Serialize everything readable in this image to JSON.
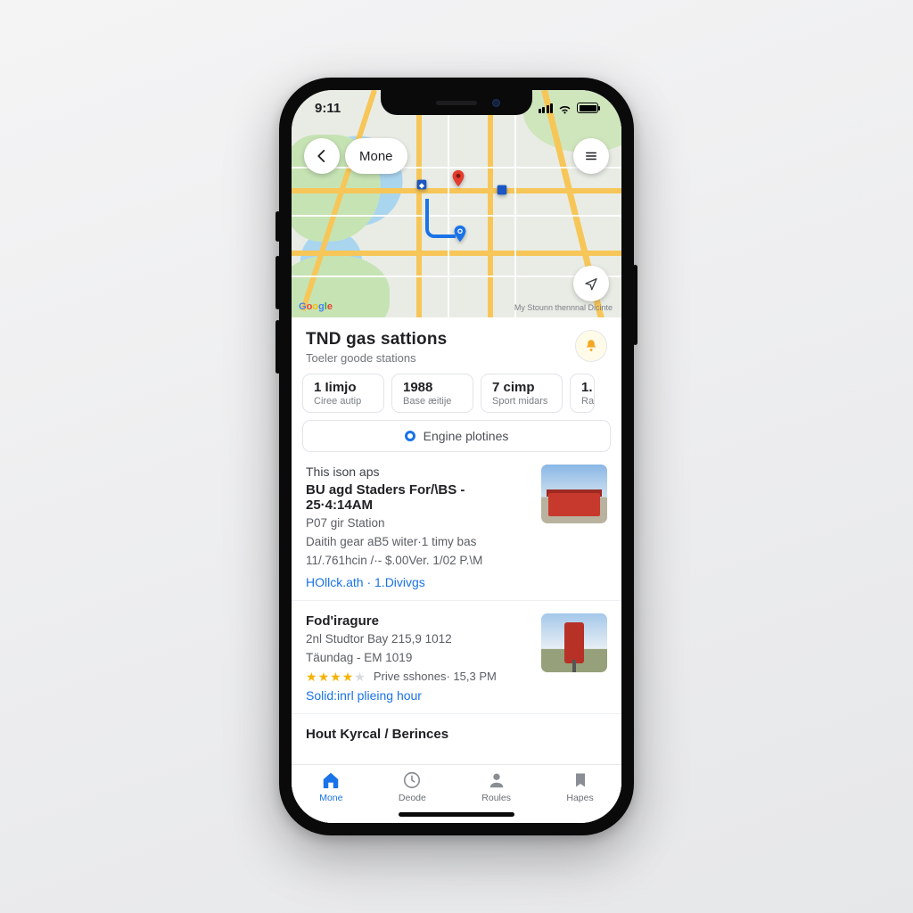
{
  "status": {
    "time": "9:11"
  },
  "map": {
    "back_pill_label": "Mone",
    "logo_text": "Google",
    "attribution": "My Stounn thennnal Dicinte"
  },
  "sheet": {
    "title": "TND gas sattions",
    "subtitle": "Toeler goode stations",
    "chips": [
      {
        "title": "1 Iimjo",
        "sub": "Ciree autip"
      },
      {
        "title": "1988",
        "sub": "Base æitije"
      },
      {
        "title": "7 cimp",
        "sub": "Sport midars"
      },
      {
        "title": "1.",
        "sub": "Ra"
      }
    ],
    "wide_chip": "Engine plotines",
    "results": [
      {
        "eyebrow": "This ison aps",
        "name": "BU agd Staders For/\\BS - 25·4:14AM",
        "line1": "P07 gir Station",
        "line2": "Daitih gear aB5 witer·1 timy bas",
        "line3": "11/.761hcin /·- $.00Ver. 1/02 P.\\M",
        "link": "HOllck.ath · 1.Divivgs"
      },
      {
        "name": "Fod'iragure",
        "line1": "2nl Studtor Bay 215,9 1012",
        "line2": "Täundag - EM  1019",
        "stars_meta": "Prive sshones· 15,3 PM",
        "link": "Solid:inrl plieing hour"
      },
      {
        "name": "Hout Kyrcal / Berinces"
      }
    ]
  },
  "tabs": [
    {
      "id": "home",
      "label": "Mone"
    },
    {
      "id": "deode",
      "label": "Deode"
    },
    {
      "id": "routes",
      "label": "Roules"
    },
    {
      "id": "hapes",
      "label": "Hapes"
    }
  ]
}
